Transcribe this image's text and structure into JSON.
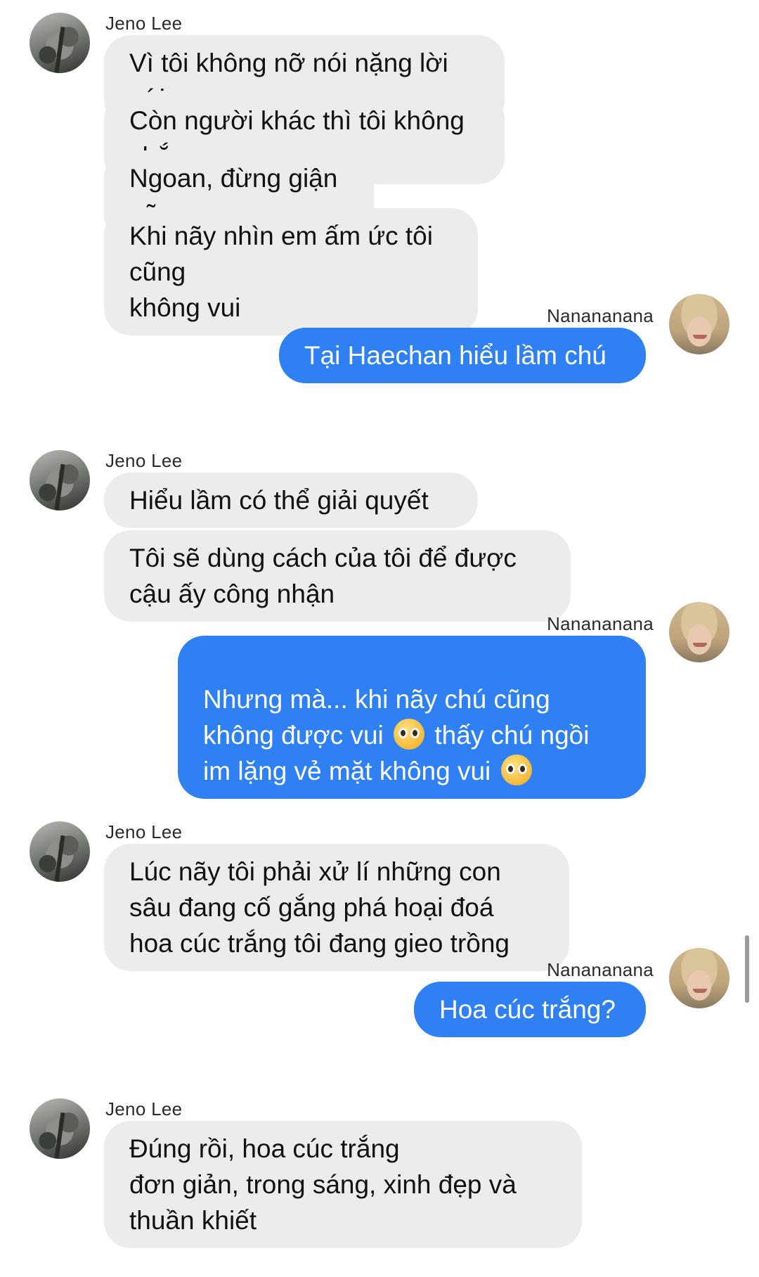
{
  "participants": {
    "other": {
      "name": "Jeno Lee",
      "avatar_icon": "tree-photo-avatar"
    },
    "self": {
      "name": "Nanananana",
      "avatar_icon": "blond-person-avatar"
    }
  },
  "colors": {
    "incoming_bubble": "#ececec",
    "outgoing_bubble": "#2f80f2"
  },
  "messages": [
    {
      "sender": "Jeno Lee",
      "text": "Vì tôi không nỡ nói nặng lời với em"
    },
    {
      "sender": "Jeno Lee",
      "text": "Còn người khác thì tôi không chắc"
    },
    {
      "sender": "Jeno Lee",
      "text": "Ngoan, đừng giận nữa"
    },
    {
      "sender": "Jeno Lee",
      "text": "Khi nãy nhìn em ấm ức tôi cũng\nkhông vui"
    },
    {
      "sender": "Nanananana",
      "text": "Tại Haechan hiểu lầm chú"
    },
    {
      "sender": "Jeno Lee",
      "text": "Hiểu lầm có thể giải quyết"
    },
    {
      "sender": "Jeno Lee",
      "text": "Tôi sẽ dùng cách của tôi để được\ncậu ấy công nhận"
    },
    {
      "sender": "Nanananana",
      "parts": [
        "Nhưng mà... khi nãy chú cũng\nkhông được vui ",
        " thấy chú ngồi\nim lặng vẻ mặt không vui "
      ],
      "emoji": "pleading-face-emoji"
    },
    {
      "sender": "Jeno Lee",
      "text": "Lúc nãy tôi phải xử lí những con\nsâu đang cố gắng phá hoại đoá\nhoa cúc trắng tôi đang gieo trồng"
    },
    {
      "sender": "Nanananana",
      "text": "Hoa cúc trắng?"
    },
    {
      "sender": "Jeno Lee",
      "text": "Đúng rồi, hoa cúc trắng\n đơn giản, trong sáng, xinh đẹp và\nthuần khiết"
    }
  ]
}
